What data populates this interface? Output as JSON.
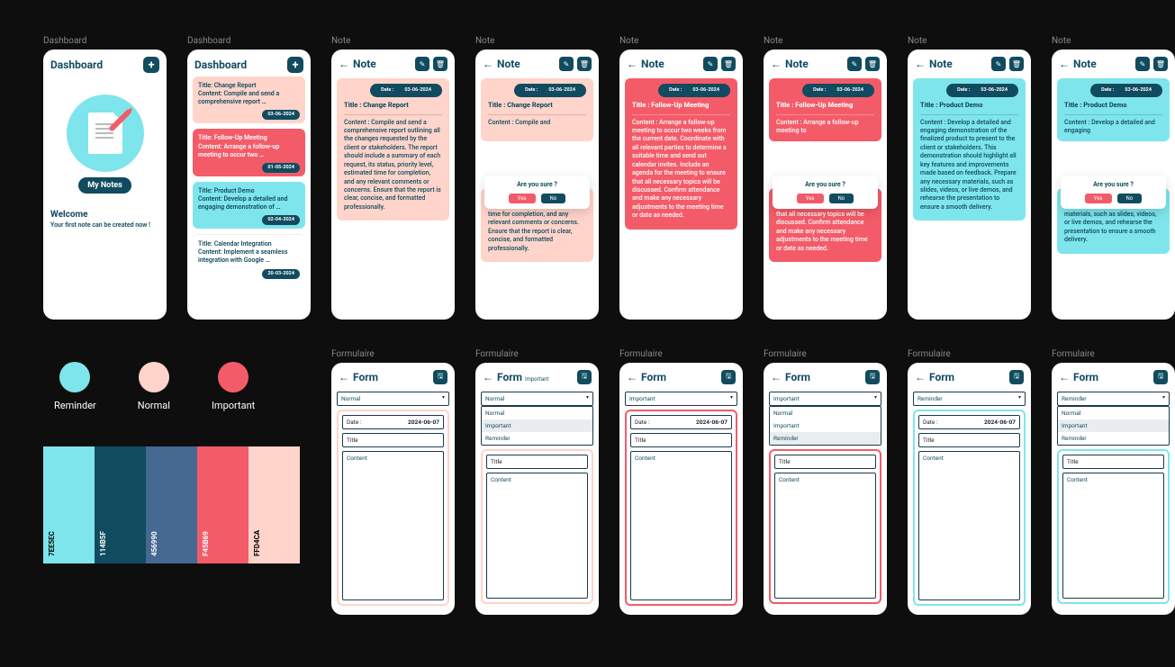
{
  "labels": {
    "dashboard": "Dashboard",
    "note": "Note",
    "form": "Formulaire"
  },
  "header": {
    "dashboard_title": "Dashboard",
    "note_title": "Note",
    "form_title": "Form",
    "important_suffix": "Important"
  },
  "icons": {
    "add": "+",
    "back": "←",
    "edit": "✎",
    "delete": "🗑",
    "save": "🖫"
  },
  "dashboard_empty": {
    "chip": "My Notes",
    "welcome_heading": "Welcome",
    "welcome_text": "Your first note can be created now !"
  },
  "dashboard_list": {
    "items": [
      {
        "type": "normal",
        "title": "Title: Change Report",
        "content": "Content: Compile and send a comprehensive report …",
        "date": "03-06-2024"
      },
      {
        "type": "important",
        "title": "Title: Follow-Up Meeting",
        "content": "Content: Arrange a follow-up meeting to occur two  …",
        "date": "01-05-2024"
      },
      {
        "type": "reminder",
        "title": "Title: Product Demo",
        "content": "Content: Develop a detailed and engaging demonstration of …",
        "date": "02-04-2024"
      },
      {
        "type": "plain",
        "title": "Title: Calendar Integration",
        "content": "Content: Implement a seamless integration with Google …",
        "date": "20-03-2024"
      }
    ]
  },
  "notes": {
    "date_label_prefix": "Date : ",
    "normal": {
      "date": "03-06-2024",
      "title": "Title : Change Report",
      "content_short": "Content :  Compile and",
      "content_full": "Content :  Compile and send a comprehensive report outlining all the changes requested by the client or stakeholders. The report should include a summary of each request, its status, priority level, estimated time for completion, and any relevant comments or concerns. Ensure that the report is clear, concise, and formatted professionally.",
      "content_remainder": "summary of each request, its status, priority level, estimated time for completion, and any relevant comments or concerns. Ensure that the report is clear, concise, and formatted professionally."
    },
    "important": {
      "date": "03-06-2024",
      "title": "Title : Follow-Up Meeting",
      "content_short": "Content :  Arrange a follow-up meeting to",
      "content_full": "Content :  Arrange a follow-up meeting to occur two weeks from the current date. Coordinate with all relevant parties to determine a suitable time and send out calendar invites. Include an agenda for the meeting to ensure that all necessary topics will be discussed. Confirm attendance and make any necessary adjustments to the meeting time or date as needed.",
      "content_remainder": "calendar invites. Include an agenda for the meeting to ensure that all necessary topics will be discussed. Confirm attendance and make any necessary adjustments to the meeting time or date as needed."
    },
    "reminder": {
      "date": "03-06-2024",
      "title": "Title : Product Demo",
      "content_short": "Content :  Develop a detailed and engaging",
      "content_full": "Content :  Develop a detailed and engaging demonstration of the finalized product to present to the client or stakeholders. This demonstration should highlight all key features and improvements made based on feedback. Prepare any necessary materials, such as slides, videos, or live demos, and rehearse the presentation to ensure a smooth delivery.",
      "content_remainder": "and improvements made based on feedback. Prepare any necessary materials, such as slides, videos, or live demos, and rehearse the presentation to ensure a smooth delivery."
    }
  },
  "confirm": {
    "question": "Are you sure ?",
    "yes": "Yes",
    "no": "No"
  },
  "form": {
    "types": {
      "normal": "Normal",
      "important": "Important",
      "reminder": "Reminder"
    },
    "date_label": "Date :",
    "date_value": "2024-06-07",
    "title_placeholder": "Title",
    "content_placeholder": "Content"
  },
  "legend": {
    "reminder": "Reminder",
    "normal": "Normal",
    "important": "Important"
  },
  "palette": [
    {
      "hex": "7EE5EC",
      "css": "#7EE5EC",
      "tone": "light"
    },
    {
      "hex": "114B5F",
      "css": "#114B5F",
      "tone": "dark"
    },
    {
      "hex": "456990",
      "css": "#456990",
      "tone": "dark"
    },
    {
      "hex": "F45B69",
      "css": "#F45B69",
      "tone": "dark"
    },
    {
      "hex": "FFD4CA",
      "css": "#FFD4CA",
      "tone": "light"
    }
  ]
}
